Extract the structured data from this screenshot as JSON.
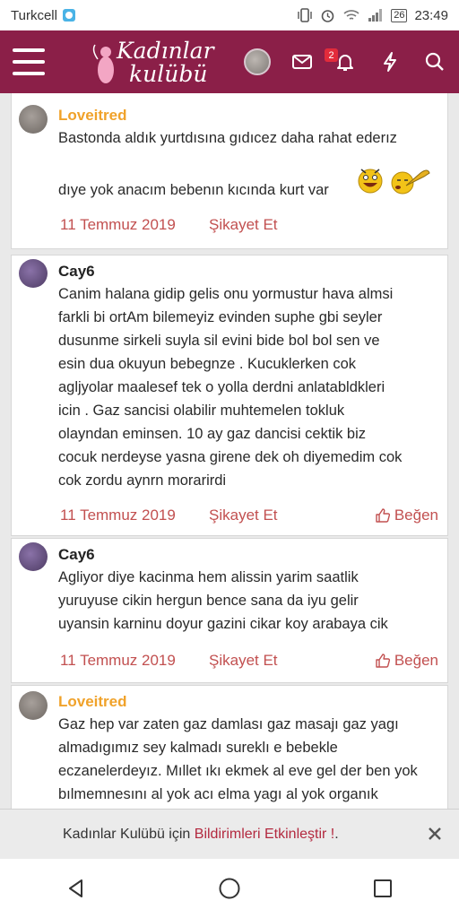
{
  "statusbar": {
    "carrier": "Turkcell",
    "battery": "26",
    "time": "23:49"
  },
  "header": {
    "logo_line1": "Kadınlar",
    "logo_line2": "kulübü",
    "notification_count": "2"
  },
  "posts": [
    {
      "username": "Loveitred",
      "text": [
        "Bastonda aldık yurtdısına gıdıcez daha rahat ederız",
        "",
        "dıye yok anacım bebenın kıcında kurt var"
      ],
      "date": "11 Temmuz 2019",
      "report": "Şikayet Et"
    },
    {
      "username": "Cay6",
      "text": [
        "Canim halana gidip gelis onu yormustur hava almsi",
        "farkli bi ortAm bilemeyiz evinden suphe gbi seyler",
        "dusunme sirkeli suyla sil evini bide bol bol sen ve",
        "esin dua okuyun bebegnze . Kucuklerken cok",
        "agljyolar maalesef tek o yolla derdni anlatabldkleri",
        "icin . Gaz sancisi olabilir muhtemelen tokluk",
        "olayndan eminsen. 10 ay gaz dancisi cektik biz",
        "cocuk nerdeyse yasna girene dek oh diyemedim cok",
        "cok zordu aynrn morarirdi"
      ],
      "date": "11 Temmuz 2019",
      "report": "Şikayet Et",
      "like": "Beğen"
    },
    {
      "username": "Cay6",
      "text": [
        "Agliyor diye kacinma hem alissin yarim saatlik",
        "yuruyuse cikin hergun bence sana da iyu gelir",
        "uyansin karninu doyur gazini cikar koy arabaya cik"
      ],
      "date": "11 Temmuz 2019",
      "report": "Şikayet Et",
      "like": "Beğen"
    },
    {
      "username": "Loveitred",
      "text": [
        "Gaz hep var zaten gaz damlası gaz masajı gaz yagı",
        "almadıgımız sey kalmadı sureklı e bebekle",
        "eczanelerdeyız. Mıllet ıkı ekmek al eve gel der ben yok",
        "bılmemnesını al yok acı elma yagı al yok organık"
      ]
    }
  ],
  "notice": {
    "prefix": "Kadınlar Kulübü için ",
    "link": "Bildirimleri Etkinleştir !",
    "suffix": "."
  },
  "colors": {
    "brand": "#8b1f48",
    "accent_orange": "#f0a22a",
    "link_red": "#c25050"
  },
  "icons": [
    "menu-icon",
    "envelope-icon",
    "bell-icon",
    "lightning-icon",
    "search-icon",
    "thumbs-up-icon",
    "close-icon",
    "back-icon",
    "home-icon",
    "recents-icon"
  ]
}
